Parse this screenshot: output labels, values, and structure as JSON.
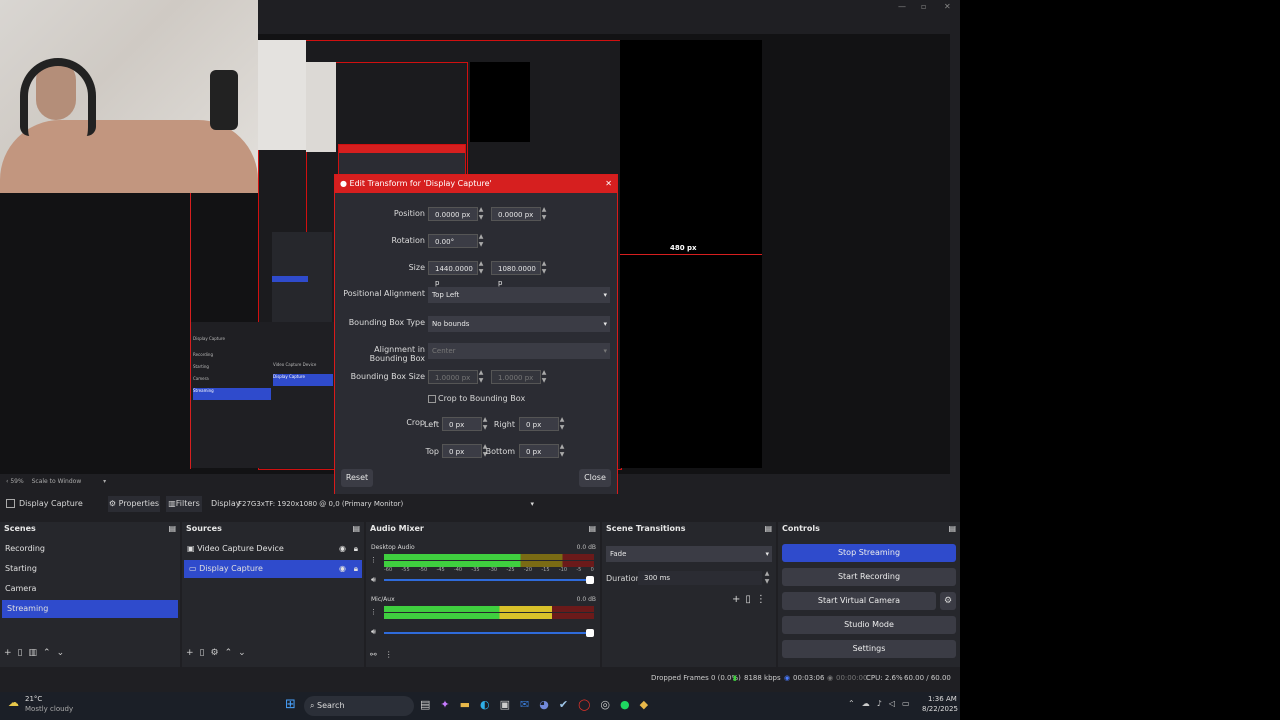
{
  "preview": {
    "dimension_label": "480 px",
    "zoom": "59%",
    "scale_mode": "Scale to Window"
  },
  "mini_scenes": [
    "Recording",
    "Starting",
    "Camera",
    "Streaming"
  ],
  "mini_sources": [
    "Video Capture Device",
    "Display Capture"
  ],
  "dialog": {
    "title": "Edit Transform for 'Display Capture'",
    "position_label": "Position",
    "position_x": "0.0000 px",
    "position_y": "0.0000 px",
    "rotation_label": "Rotation",
    "rotation": "0.00°",
    "size_label": "Size",
    "size_w": "1440.0000 p",
    "size_h": "1080.0000 p",
    "pos_align_label": "Positional Alignment",
    "pos_align": "Top Left",
    "bbox_type_label": "Bounding Box Type",
    "bbox_type": "No bounds",
    "align_in_bbox_label": "Alignment in Bounding Box",
    "align_in_bbox": "Center",
    "bbox_size_label": "Bounding Box Size",
    "bbox_w": "1.0000 px",
    "bbox_h": "1.0000 px",
    "crop_to_bbox": "Crop to Bounding Box",
    "crop_label": "Crop",
    "left_label": "Left",
    "left": "0 px",
    "right_label": "Right",
    "right": "0 px",
    "top_label": "Top",
    "top": "0 px",
    "bottom_label": "Bottom",
    "bottom": "0 px",
    "reset": "Reset",
    "close": "Close"
  },
  "toolbar": {
    "source_name": "Display Capture",
    "properties": "Properties",
    "filters": "Filters",
    "display_label": "Display",
    "display_value": "F27G3xTF: 1920x1080 @ 0,0 (Primary Monitor)"
  },
  "scenes": {
    "title": "Scenes",
    "items": [
      "Recording",
      "Starting",
      "Camera",
      "Streaming"
    ]
  },
  "sources": {
    "title": "Sources",
    "items": [
      "Video Capture Device",
      "Display Capture"
    ]
  },
  "mixer": {
    "title": "Audio Mixer",
    "channels": [
      {
        "name": "Desktop Audio",
        "db": "0.0 dB"
      },
      {
        "name": "Mic/Aux",
        "db": "0.0 dB"
      }
    ],
    "ticks": [
      "-60",
      "-55",
      "-50",
      "-45",
      "-40",
      "-35",
      "-30",
      "-25",
      "-20",
      "-15",
      "-10",
      "-5",
      "0"
    ]
  },
  "transitions": {
    "title": "Scene Transitions",
    "type": "Fade",
    "duration_label": "Duration",
    "duration": "300 ms"
  },
  "controls": {
    "title": "Controls",
    "stop_streaming": "Stop Streaming",
    "start_recording": "Start Recording",
    "start_virtual_camera": "Start Virtual Camera",
    "studio_mode": "Studio Mode",
    "settings": "Settings"
  },
  "status": {
    "dropped": "Dropped Frames 0 (0.0%)",
    "bitrate": "8188 kbps",
    "stream_time": "00:03:06",
    "rec_time": "00:00:00",
    "cpu": "CPU: 2.6%",
    "fps": "60.00 / 60.00 FPS"
  },
  "taskbar": {
    "temp": "21°C",
    "weather": "Mostly cloudy",
    "search": "Search",
    "time": "1:36 AM",
    "date": "8/22/2025"
  },
  "colors": {
    "accent_blue": "#2f4bcc",
    "selection_red": "#d61f1f",
    "meter_green": "#3fcf3f",
    "meter_yellow": "#d9c12a"
  }
}
